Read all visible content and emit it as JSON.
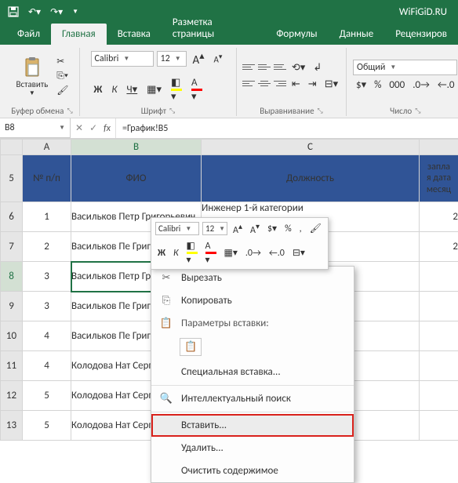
{
  "titlebar": {
    "document_name": "WiFiGiD.RU"
  },
  "tabs": {
    "file": "Файл",
    "home": "Главная",
    "insert": "Вставка",
    "page_layout": "Разметка страницы",
    "formulas": "Формулы",
    "data": "Данные",
    "review": "Рецензиров"
  },
  "ribbon": {
    "clipboard": {
      "paste": "Вставить",
      "title": "Буфер обмена"
    },
    "font": {
      "name": "Calibri",
      "size": "12",
      "bold": "Ж",
      "italic": "К",
      "underline": "Ч",
      "title": "Шрифт"
    },
    "alignment": {
      "title": "Выравнивание"
    },
    "number": {
      "format": "Общий",
      "title": "Число"
    }
  },
  "name_box": "B8",
  "formula": "=График!B5",
  "columns": {
    "A": "A",
    "B": "B",
    "C": "C"
  },
  "chart_data": {
    "type": "table",
    "headers": {
      "col_a": "№ п/п",
      "col_b": "ФИО",
      "col_c": "Должность",
      "col_d_1": "запла",
      "col_d_2": "я дата",
      "col_d_3": "месяц"
    },
    "rows": [
      {
        "rownum": "6",
        "n": "1",
        "fio": "Васильков Петр Григорьевич",
        "pos": "Инженер 1-й категории",
        "d": "2"
      },
      {
        "rownum": "7",
        "n": "2",
        "fio": "Васильков Пе Григорьевич",
        "pos": "",
        "d": "2"
      },
      {
        "rownum": "8",
        "n": "3",
        "fio": "Васильков Петр Григорьевич",
        "pos": "",
        "d": ""
      },
      {
        "rownum": "9",
        "n": "3",
        "fio": "Васильков Пе Григорьевич",
        "pos": "",
        "d": ""
      },
      {
        "rownum": "10",
        "n": "4",
        "fio": "Васильков Пе Григорьевич",
        "pos": "",
        "d": ""
      },
      {
        "rownum": "11",
        "n": "4",
        "fio": "Колодова Нат Сергеевна",
        "pos": "",
        "d": ""
      },
      {
        "rownum": "12",
        "n": "5",
        "fio": "Колодова Нат Сергеевна",
        "pos": "",
        "d": ""
      },
      {
        "rownum": "13",
        "n": "5",
        "fio": "Колодова Нат Сергеевна",
        "pos": "",
        "d": ""
      }
    ]
  },
  "mini_toolbar": {
    "font": "Calibri",
    "size": "12",
    "bold": "Ж",
    "italic": "К"
  },
  "context_menu": {
    "cut": "Вырезать",
    "copy": "Копировать",
    "paste_options": "Параметры вставки:",
    "paste_special": "Специальная вставка...",
    "smart_lookup": "Интеллектуальный поиск",
    "insert": "Вставить...",
    "delete": "Удалить...",
    "clear": "Очистить содержимое"
  }
}
